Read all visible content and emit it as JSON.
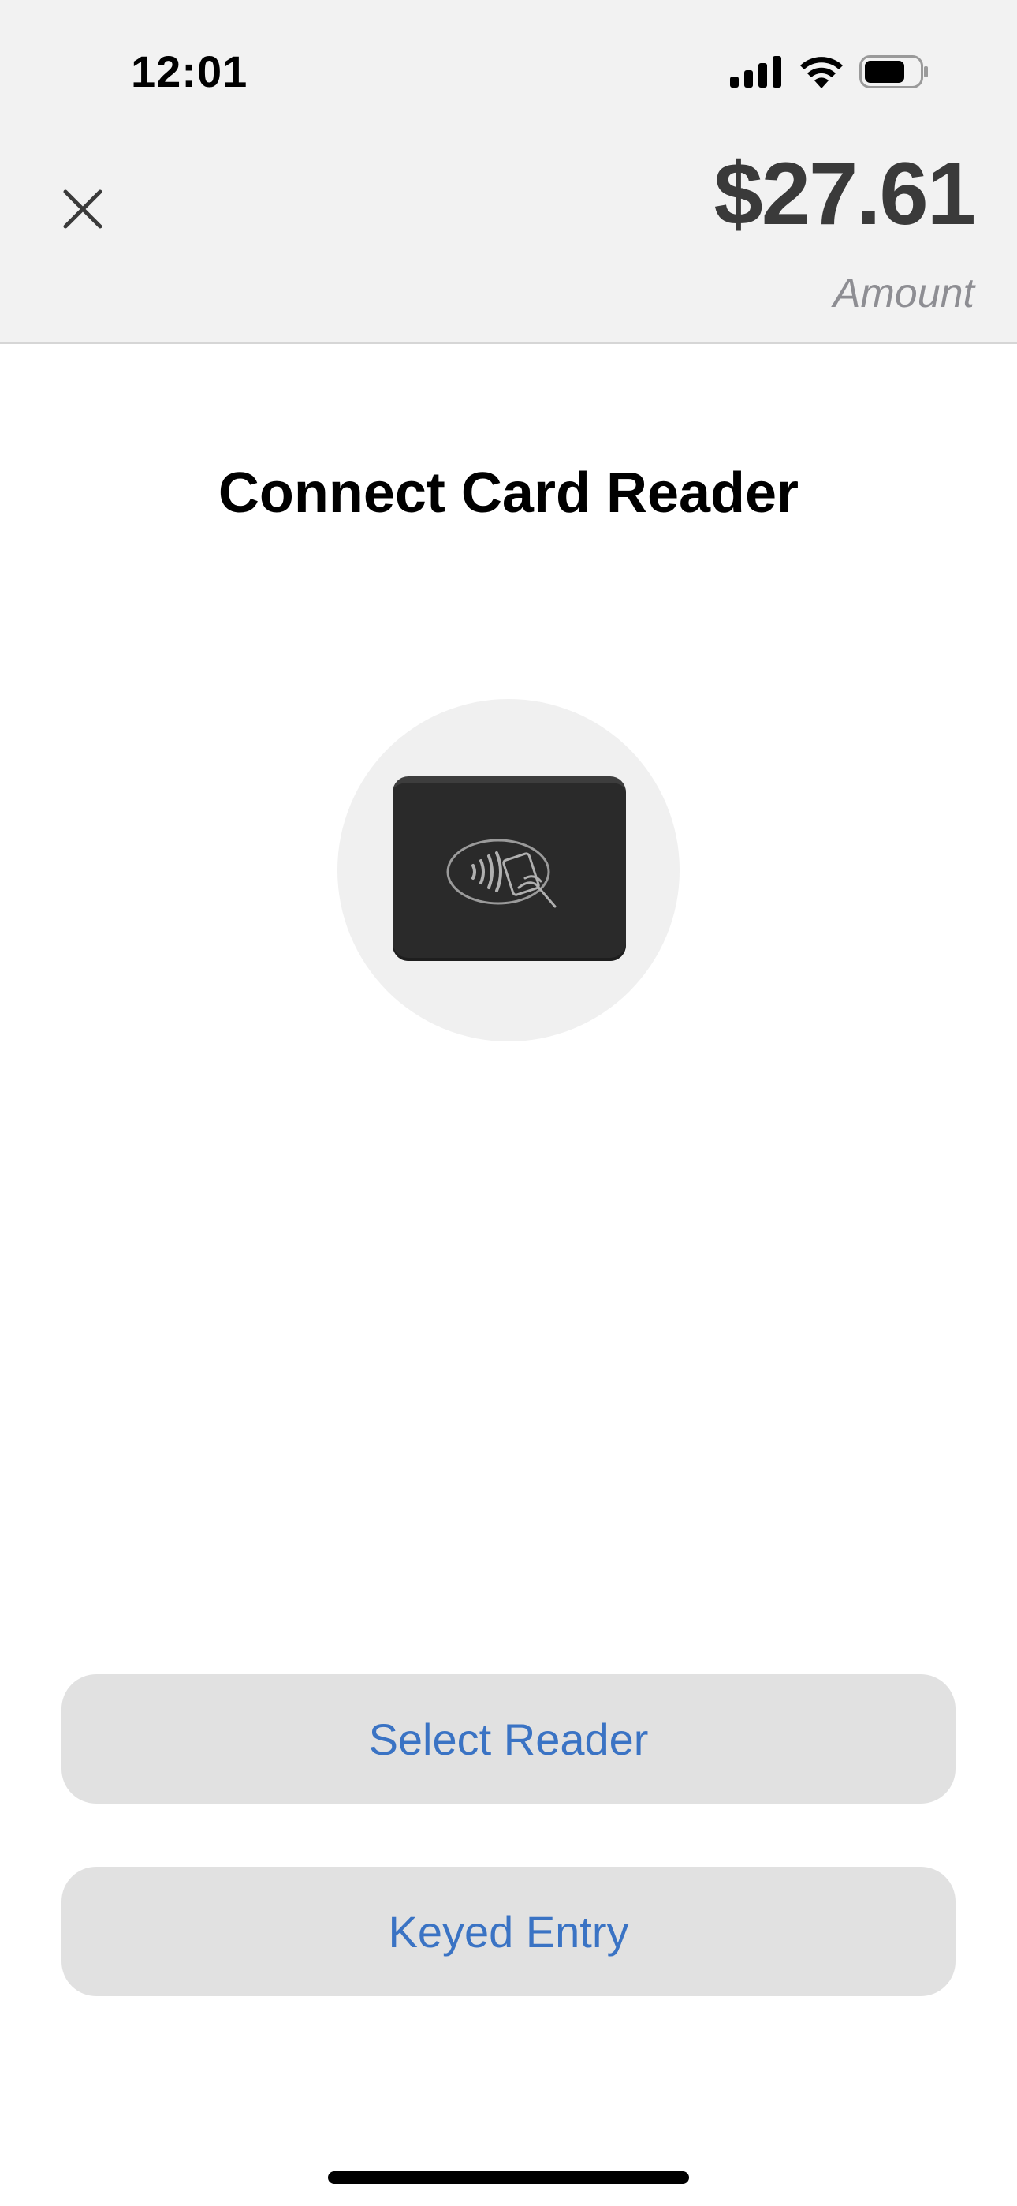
{
  "status_bar": {
    "time": "12:01",
    "icons": [
      "cellular-signal-icon",
      "wifi-icon",
      "battery-icon"
    ]
  },
  "header": {
    "close_icon": "close-icon",
    "amount": "$27.61",
    "amount_label": "Amount"
  },
  "main": {
    "title": "Connect Card Reader",
    "illustration_icon": "card-reader-contactless-icon"
  },
  "actions": {
    "select_reader_label": "Select Reader",
    "keyed_entry_label": "Keyed Entry"
  },
  "colors": {
    "header_background": "#f2f2f2",
    "button_background": "#e1e1e1",
    "button_text": "#3a73c4",
    "amount_text": "#3a3a3a",
    "label_gray": "#8e8e93"
  }
}
